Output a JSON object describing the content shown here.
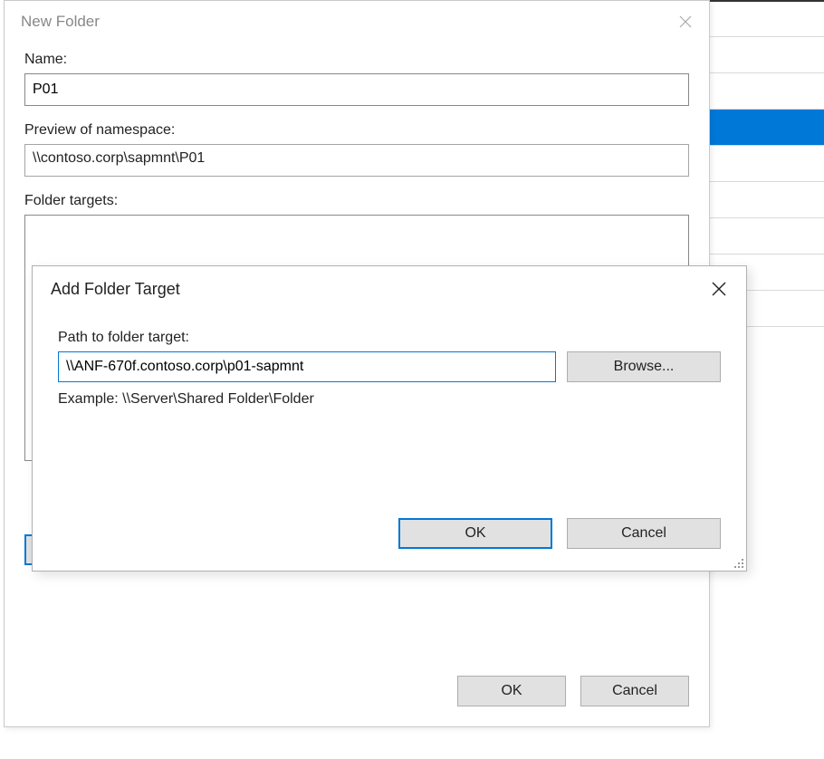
{
  "newFolder": {
    "title": "New Folder",
    "nameLabel": "Name:",
    "nameValue": "P01",
    "previewLabel": "Preview of namespace:",
    "previewValue": "\\\\contoso.corp\\sapmnt\\P01",
    "targetsLabel": "Folder targets:",
    "okLabel": "OK",
    "cancelLabel": "Cancel"
  },
  "addTarget": {
    "title": "Add Folder Target",
    "pathLabel": "Path to folder target:",
    "pathValue": "\\\\ANF-670f.contoso.corp\\p01-sapmnt",
    "browseLabel": "Browse...",
    "exampleText": "Example: \\\\Server\\Shared Folder\\Folder",
    "okLabel": "OK",
    "cancelLabel": "Cancel"
  }
}
